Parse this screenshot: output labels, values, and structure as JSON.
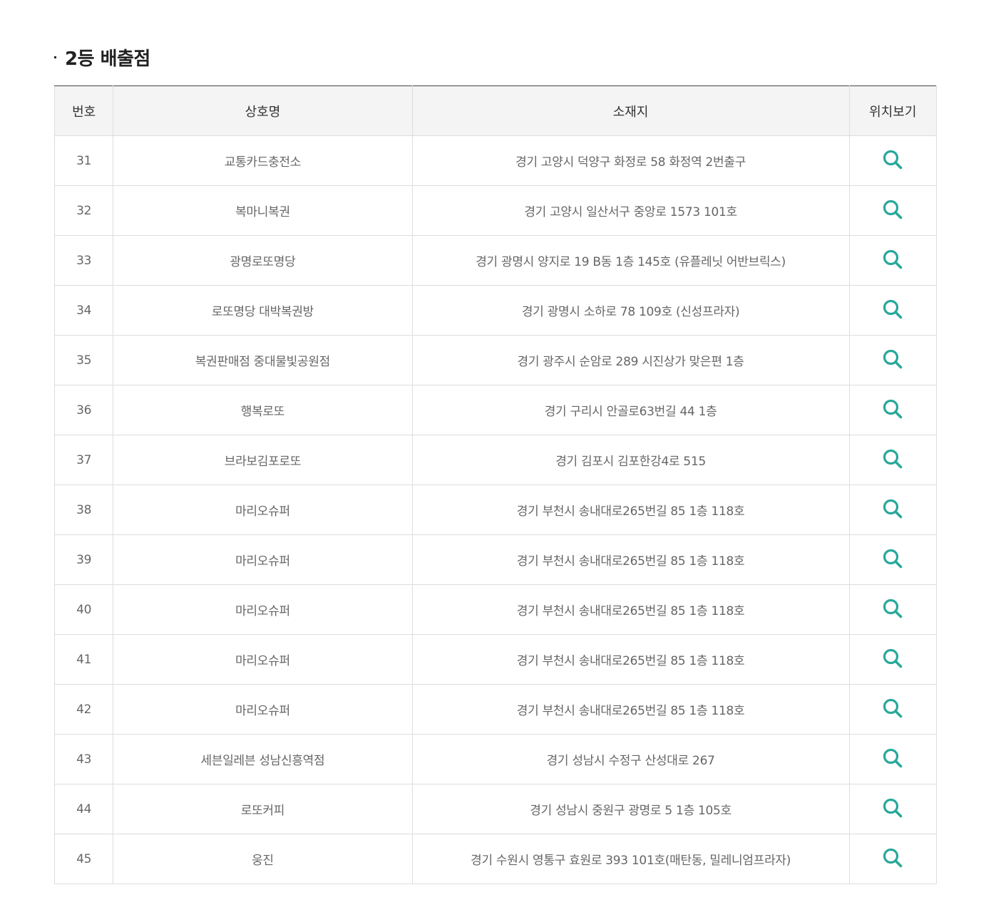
{
  "page": {
    "section_title": "2등 배출점"
  },
  "table": {
    "headers": {
      "no": "번호",
      "name": "상호명",
      "address": "소재지",
      "map": "위치보기"
    },
    "rows": [
      {
        "no": "31",
        "name": "교통카드충전소",
        "address": "경기 고양시 덕양구 화정로 58 화정역 2번출구"
      },
      {
        "no": "32",
        "name": "복마니복권",
        "address": "경기 고양시 일산서구 중앙로 1573 101호"
      },
      {
        "no": "33",
        "name": "광명로또명당",
        "address": "경기 광명시 양지로 19 B동 1층 145호 (유플레닛 어반브릭스)"
      },
      {
        "no": "34",
        "name": "로또명당 대박복권방",
        "address": "경기 광명시 소하로 78 109호 (신성프라자)"
      },
      {
        "no": "35",
        "name": "복권판매점 중대물빛공원점",
        "address": "경기 광주시 순암로 289 시진상가 맞은편 1층"
      },
      {
        "no": "36",
        "name": "행복로또",
        "address": "경기 구리시 안골로63번길 44 1층"
      },
      {
        "no": "37",
        "name": "브라보김포로또",
        "address": "경기 김포시 김포한강4로 515"
      },
      {
        "no": "38",
        "name": "마리오슈퍼",
        "address": "경기 부천시 송내대로265번길 85 1층 118호"
      },
      {
        "no": "39",
        "name": "마리오슈퍼",
        "address": "경기 부천시 송내대로265번길 85 1층 118호"
      },
      {
        "no": "40",
        "name": "마리오슈퍼",
        "address": "경기 부천시 송내대로265번길 85 1층 118호"
      },
      {
        "no": "41",
        "name": "마리오슈퍼",
        "address": "경기 부천시 송내대로265번길 85 1층 118호"
      },
      {
        "no": "42",
        "name": "마리오슈퍼",
        "address": "경기 부천시 송내대로265번길 85 1층 118호"
      },
      {
        "no": "43",
        "name": "세븐일레븐 성남신흥역점",
        "address": "경기 성남시 수정구 산성대로 267"
      },
      {
        "no": "44",
        "name": "로또커피",
        "address": "경기 성남시 중원구 광명로 5 1층 105호"
      },
      {
        "no": "45",
        "name": "웅진",
        "address": "경기 수원시 영통구 효원로 393 101호(매탄동, 밀레니엄프라자)"
      }
    ],
    "map_icon": "search-icon"
  },
  "colors": {
    "accent": "#27a89a",
    "header_bg": "#f4f4f4",
    "border": "#dddddd",
    "title": "#222222",
    "text": "#666666"
  }
}
